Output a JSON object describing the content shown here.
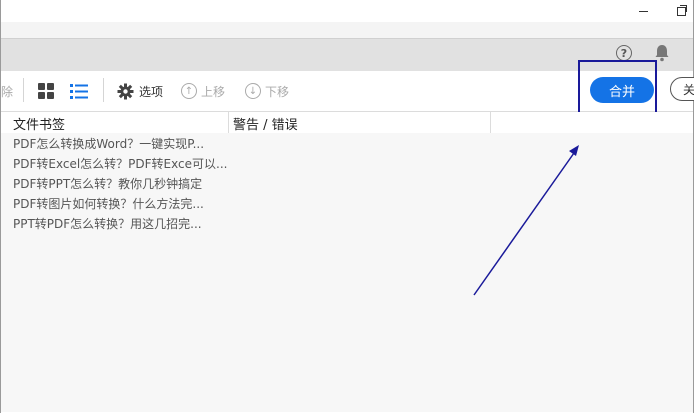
{
  "window": {
    "minimize_icon": "minimize-icon",
    "maximize_icon": "restore-icon"
  },
  "header": {
    "help_glyph": "?",
    "help_icon": "help-icon",
    "bell_icon": "bell-icon"
  },
  "toolbar": {
    "cut_label": "除",
    "grid_icon": "grid-view-icon",
    "list_icon": "list-view-icon",
    "options_label": "选项",
    "up_label": "上移",
    "down_label": "下移",
    "merge_label": "合并",
    "cancel_label": "关"
  },
  "table": {
    "columns": [
      "文件书签",
      "警告 / 错误"
    ],
    "rows": [
      "PDF怎么转换成Word？一键实现P...",
      "PDF转Excel怎么转？PDF转Exce可以...",
      "PDF转PPT怎么转？教你几秒钟搞定",
      "PDF转图片如何转换？什么方法完...",
      "PPT转PDF怎么转换？用这几招完..."
    ]
  },
  "colors": {
    "accent": "#1473e6",
    "annotation": "#1a1a9a"
  }
}
